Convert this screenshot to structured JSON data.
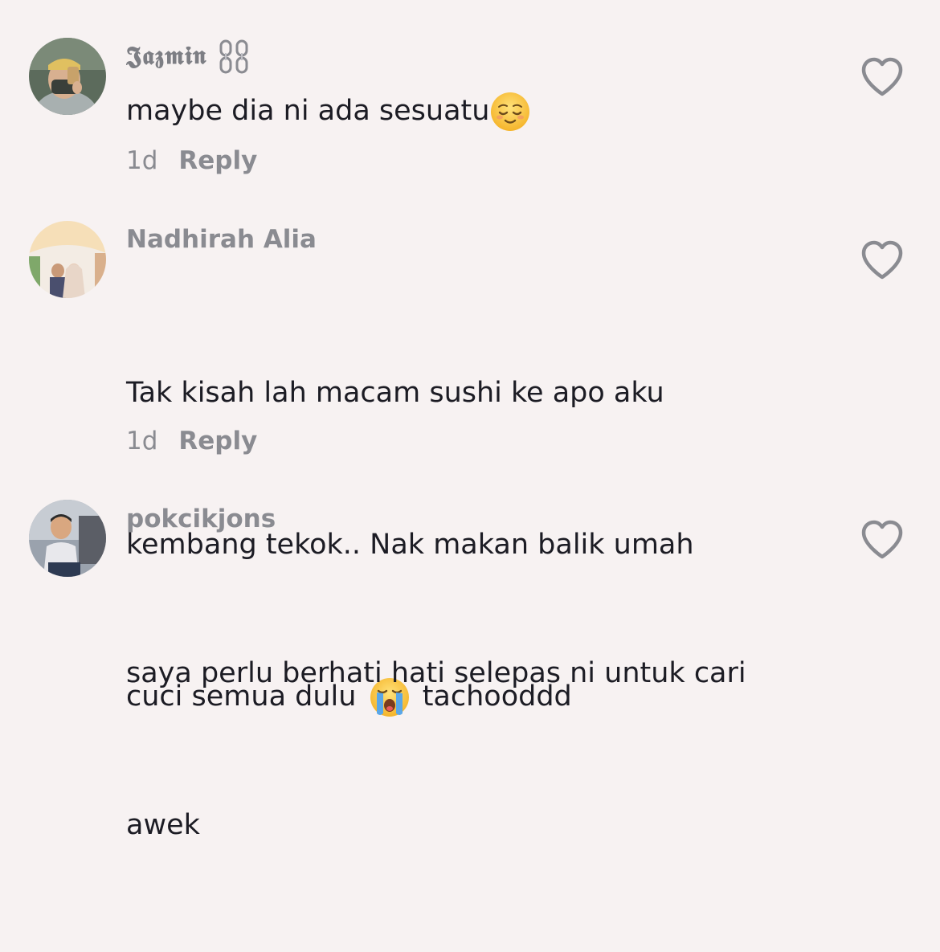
{
  "comments": [
    {
      "username": "𝕵𝖆𝖟𝖒𝖎𝖓",
      "username_suffix_icon": "chain-icon",
      "text_before": "maybe dia ni ada sesuatu",
      "emoji": "relieved-face-emoji",
      "text_after": "",
      "time": "1d",
      "reply_label": "Reply",
      "avatar": "avatar-person-mirror-selfie"
    },
    {
      "username": "Nadhirah Alia",
      "text_lines": [
        "Tak kisah lah macam sushi ke apo aku",
        "kembang tekok.. Nak makan balik umah"
      ],
      "last_line_before": "cuci semua dulu ",
      "emoji": "loudly-crying-face-emoji",
      "last_line_after": " tachooddd",
      "time": "1d",
      "reply_label": "Reply",
      "avatar": "avatar-couple-wedding"
    },
    {
      "username": "pokcikjons",
      "text_lines": [
        "saya perlu berhati hati selepas ni untuk cari",
        "awek"
      ],
      "avatar": "avatar-man-sitting"
    }
  ],
  "like_icon": "heart-outline-icon",
  "colors": {
    "background": "#f7f2f2",
    "primary_text": "#1c1c24",
    "secondary_text": "#8a8b91"
  }
}
